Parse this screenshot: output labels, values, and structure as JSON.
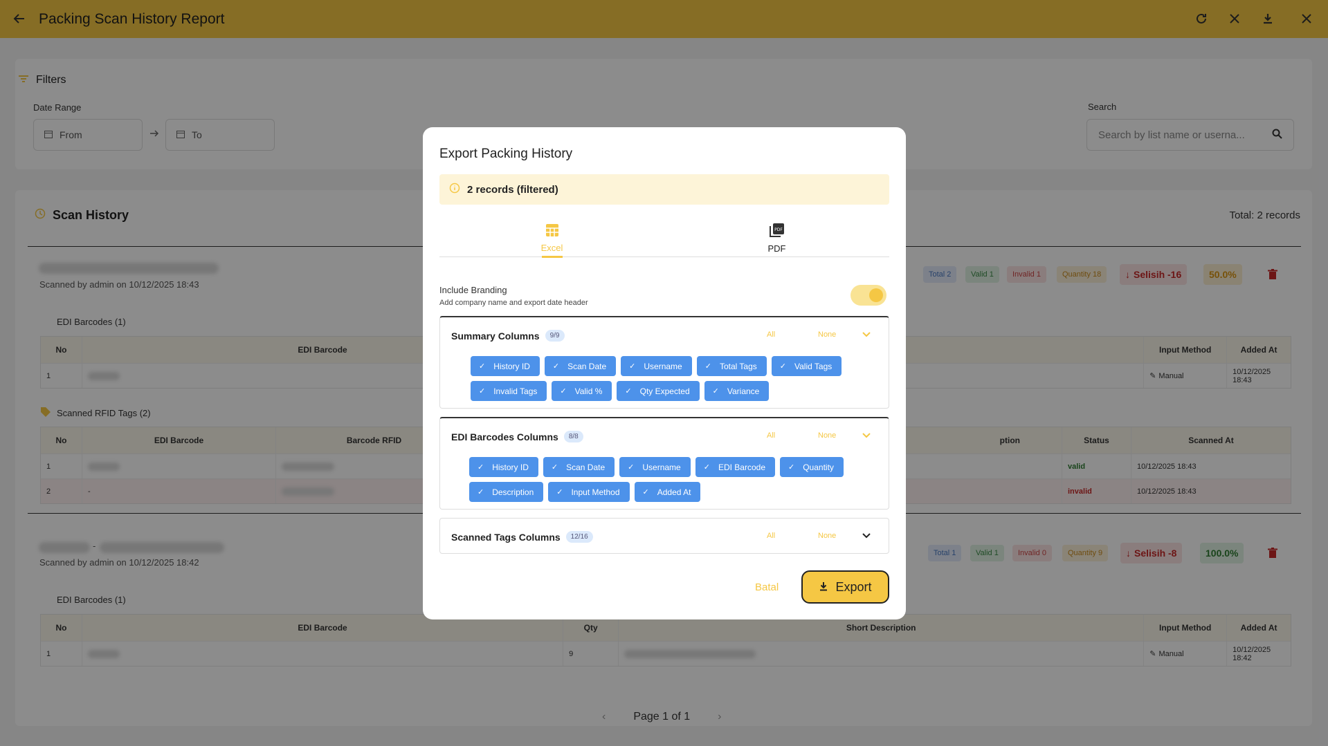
{
  "header": {
    "title": "Packing Scan History Report"
  },
  "filters": {
    "title": "Filters",
    "date_range_label": "Date Range",
    "from_placeholder": "From",
    "to_placeholder": "To",
    "search_label": "Search",
    "search_placeholder": "Search by list name or userna..."
  },
  "history": {
    "title": "Scan History",
    "total": "Total: 2 records",
    "entry1": {
      "scanned_by": "Scanned by admin on 10/12/2025 18:43",
      "chips": {
        "total": "Total 2",
        "valid": "Valid 1",
        "invalid": "Invalid 1",
        "quantity": "Quantity 18",
        "selisih": "Selisih -16",
        "percent": "50.0%"
      },
      "edi_title": "EDI Barcodes (1)",
      "edi_headers": [
        "No",
        "EDI Barcode",
        "Input Method",
        "Added At"
      ],
      "edi_row": {
        "no": "1",
        "method": "Manual",
        "added": "10/12/2025 18:43"
      },
      "rfid_title": "Scanned RFID Tags (2)",
      "rfid_headers": [
        "No",
        "EDI Barcode",
        "Barcode RFID",
        "ption",
        "Status",
        "Scanned At"
      ],
      "rfid_rows": [
        {
          "no": "1",
          "edi": "",
          "status": "valid",
          "scanned": "10/12/2025 18:43"
        },
        {
          "no": "2",
          "edi": "-",
          "status": "invalid",
          "scanned": "10/12/2025 18:43"
        }
      ]
    },
    "entry2": {
      "dash": "-",
      "scanned_by": "Scanned by admin on 10/12/2025 18:42",
      "chips": {
        "total": "Total 1",
        "valid": "Valid 1",
        "invalid": "Invalid 0",
        "quantity": "Quantity 9",
        "selisih": "Selisih -8",
        "percent": "100.0%"
      },
      "edi_title": "EDI Barcodes (1)",
      "edi_headers": [
        "No",
        "EDI Barcode",
        "Qty",
        "Short Description",
        "Input Method",
        "Added At"
      ],
      "edi_row": {
        "no": "1",
        "qty": "9",
        "method": "Manual",
        "added": "10/12/2025 18:42"
      }
    }
  },
  "pagination": {
    "label": "Page 1 of 1"
  },
  "modal": {
    "title": "Export Packing History",
    "info": "2 records (filtered)",
    "tabs": [
      {
        "label": "Excel"
      },
      {
        "label": "PDF"
      }
    ],
    "branding": {
      "title": "Include Branding",
      "desc": "Add company name and export date header",
      "enabled": true
    },
    "sections": [
      {
        "title": "Summary Columns",
        "count": "9/9",
        "all": "All",
        "none": "None",
        "columns": [
          "History ID",
          "Scan Date",
          "Username",
          "Total Tags",
          "Valid Tags",
          "Invalid Tags",
          "Valid %",
          "Qty Expected",
          "Variance"
        ]
      },
      {
        "title": "EDI Barcodes Columns",
        "count": "8/8",
        "all": "All",
        "none": "None",
        "columns": [
          "History ID",
          "Scan Date",
          "Username",
          "EDI Barcode",
          "Quantity",
          "Description",
          "Input Method",
          "Added At"
        ]
      },
      {
        "title": "Scanned Tags Columns",
        "count": "12/16",
        "all": "All",
        "none": "None",
        "columns": []
      }
    ],
    "cancel_label": "Batal",
    "export_label": "Export"
  },
  "colors": {
    "accent": "#f5c744",
    "pill": "#4d92ea",
    "danger": "#c62828",
    "success": "#2e7d32"
  }
}
